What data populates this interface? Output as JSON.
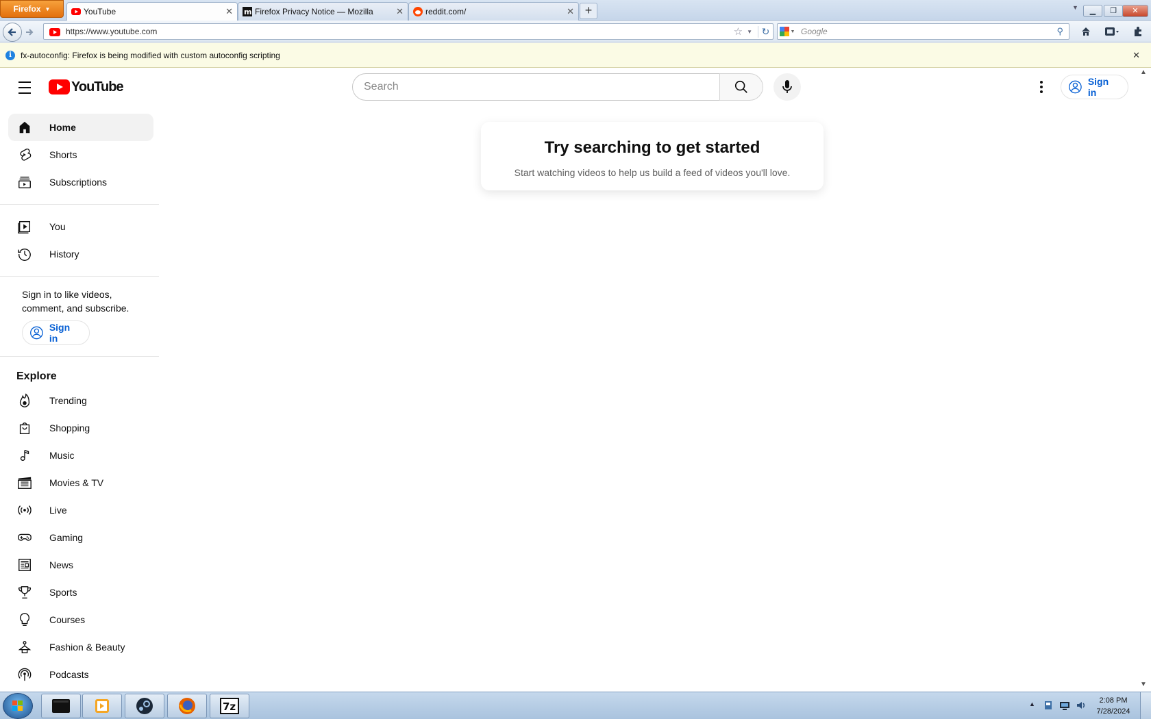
{
  "browser": {
    "menu_label": "Firefox",
    "tabs": [
      {
        "title": "YouTube",
        "active": true,
        "favicon": "youtube-favicon"
      },
      {
        "title": "Firefox Privacy Notice — Mozilla",
        "active": false,
        "favicon": "mozilla-favicon"
      },
      {
        "title": "reddit.com/",
        "active": false,
        "favicon": "reddit-favicon"
      }
    ],
    "url": "https://www.youtube.com",
    "search_engine_placeholder": "Google",
    "notification": "fx-autoconfig: Firefox is being modified with custom autoconfig scripting"
  },
  "youtube": {
    "logo_text": "YouTube",
    "search_placeholder": "Search",
    "header_signin": "Sign in",
    "sidebar_main": [
      {
        "label": "Home",
        "icon": "home-icon",
        "active": true
      },
      {
        "label": "Shorts",
        "icon": "shorts-icon"
      },
      {
        "label": "Subscriptions",
        "icon": "subscriptions-icon"
      }
    ],
    "sidebar_you": [
      {
        "label": "You",
        "icon": "you-icon"
      },
      {
        "label": "History",
        "icon": "history-icon"
      }
    ],
    "signin_prompt": "Sign in to like videos, comment, and subscribe.",
    "sidebar_signin": "Sign in",
    "explore_title": "Explore",
    "explore": [
      {
        "label": "Trending",
        "icon": "trending-icon"
      },
      {
        "label": "Shopping",
        "icon": "shopping-icon"
      },
      {
        "label": "Music",
        "icon": "music-icon"
      },
      {
        "label": "Movies & TV",
        "icon": "movies-icon"
      },
      {
        "label": "Live",
        "icon": "live-icon"
      },
      {
        "label": "Gaming",
        "icon": "gaming-icon"
      },
      {
        "label": "News",
        "icon": "news-icon"
      },
      {
        "label": "Sports",
        "icon": "sports-icon"
      },
      {
        "label": "Courses",
        "icon": "courses-icon"
      },
      {
        "label": "Fashion & Beauty",
        "icon": "fashion-icon"
      },
      {
        "label": "Podcasts",
        "icon": "podcasts-icon"
      }
    ],
    "empty_state": {
      "title": "Try searching to get started",
      "subtitle": "Start watching videos to help us build a feed of videos you'll love."
    }
  },
  "taskbar": {
    "apps": [
      "terminal-app",
      "media-player-app",
      "steam-app",
      "firefox-app",
      "7zip-app"
    ],
    "clock_time": "2:08 PM",
    "clock_date": "7/28/2024"
  },
  "colors": {
    "yt_red": "#ff0000",
    "link_blue": "#065fd4",
    "firefox_orange": "#e3700d"
  }
}
